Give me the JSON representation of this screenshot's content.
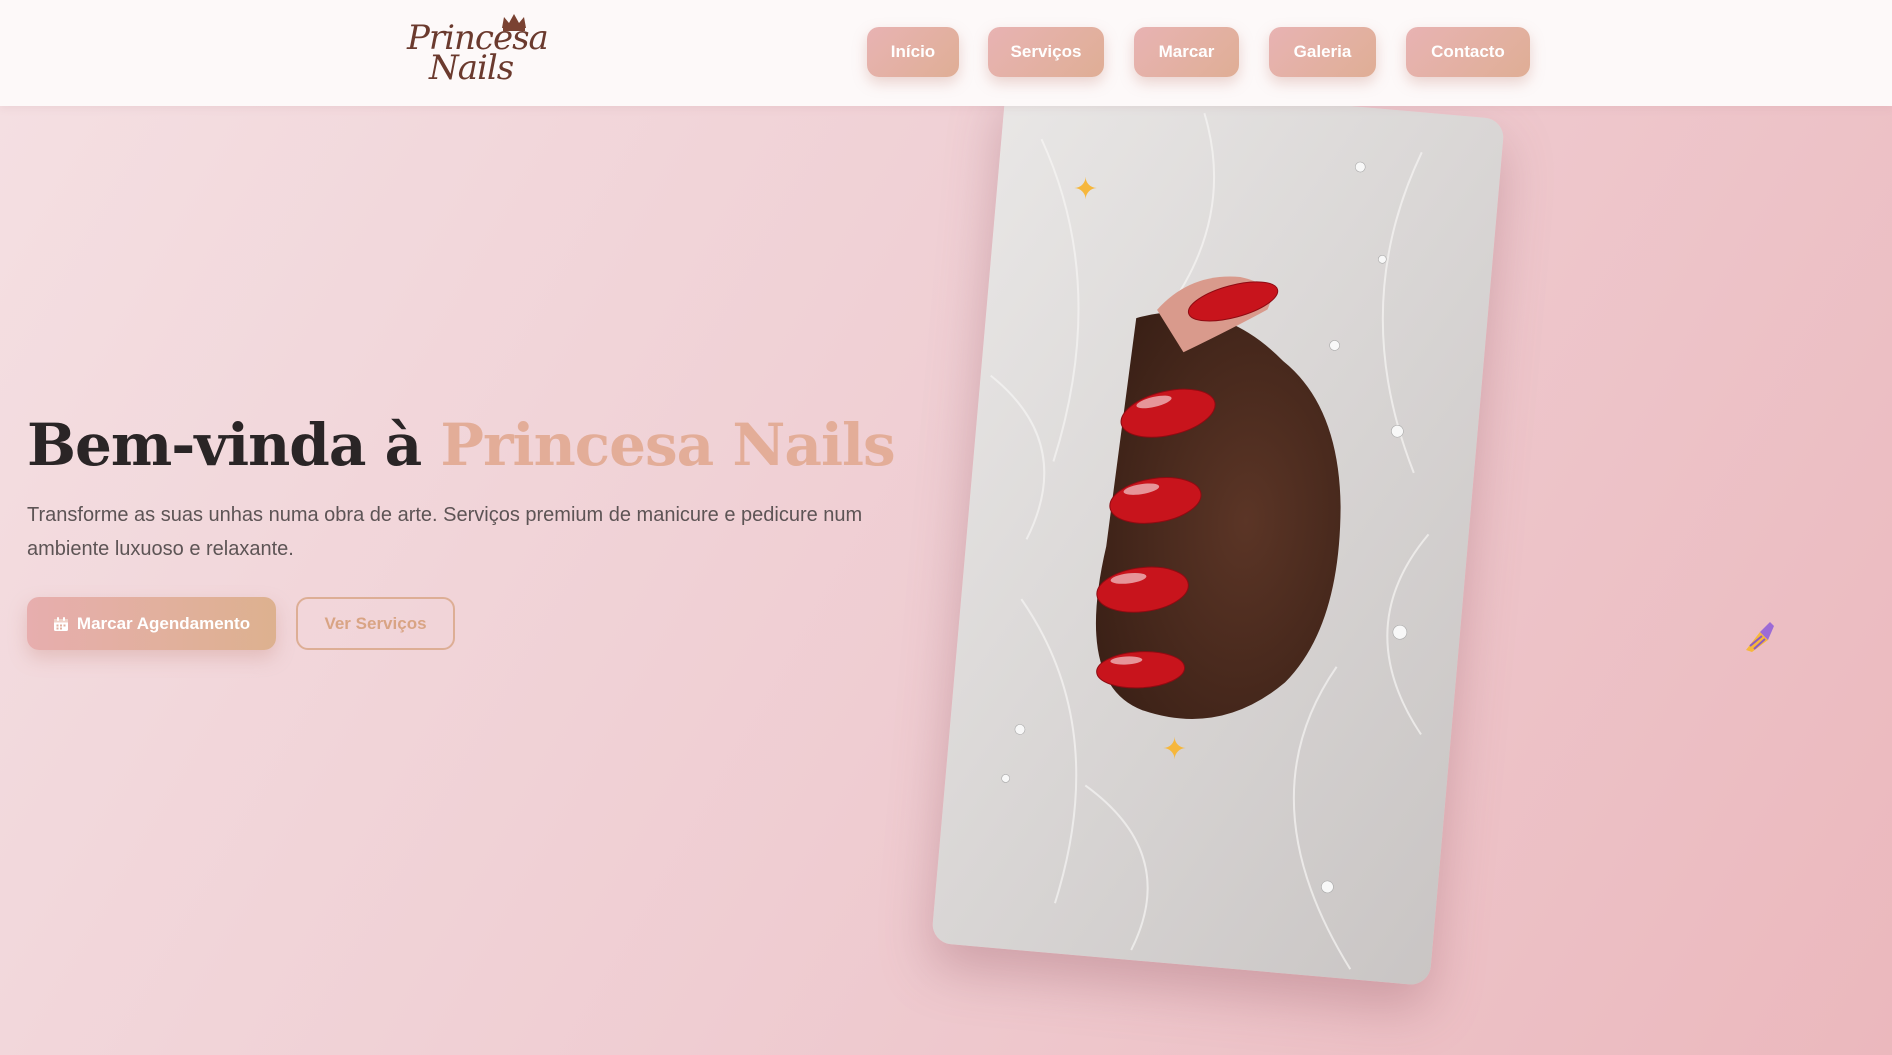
{
  "brand": {
    "logo_line1": "Princesa",
    "logo_line2": "Nails"
  },
  "nav": {
    "items": [
      {
        "label": "Início"
      },
      {
        "label": "Serviços"
      },
      {
        "label": "Marcar"
      },
      {
        "label": "Galeria"
      },
      {
        "label": "Contacto"
      }
    ]
  },
  "hero": {
    "title_prefix": "Bem-vinda à ",
    "title_accent": "Princesa Nails",
    "subtitle": "Transforme as suas unhas numa obra de arte. Serviços premium de manicure e pedicure num ambiente luxuoso e relaxante.",
    "primary_button": "Marcar Agendamento",
    "secondary_button": "Ver Serviços"
  },
  "icons": {
    "primary_button_icon": "calendar-icon",
    "decor": [
      "sparkle-icon",
      "sparkle-icon",
      "nail-polish-brush-icon"
    ]
  },
  "colors": {
    "accent": "#e3ad98",
    "button_gradient_start": "#e7aeae",
    "button_gradient_end": "#ddb18f",
    "title_text": "#2a2526",
    "nail_polish": "#c8141c"
  }
}
